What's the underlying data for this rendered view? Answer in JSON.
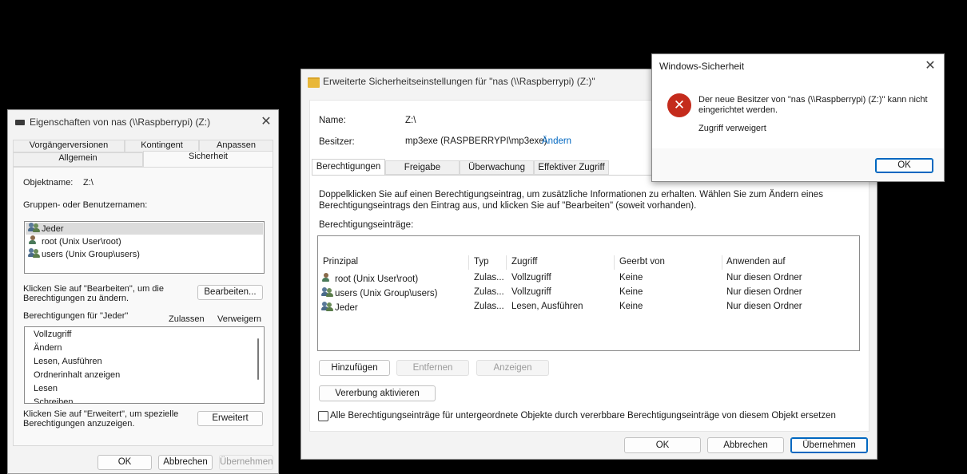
{
  "left_dialog": {
    "title": "Eigenschaften von nas (\\\\Raspberrypi) (Z:)",
    "tabs_row1": [
      "Vorgängerversionen",
      "Kontingent",
      "Anpassen"
    ],
    "tabs_row2": [
      "Allgemein",
      "Sicherheit"
    ],
    "object_name_label": "Objektname:",
    "object_name_value": "Z:\\",
    "groups_label": "Gruppen- oder Benutzernamen:",
    "groups": [
      {
        "label": "Jeder",
        "icon": "group-icon"
      },
      {
        "label": "root (Unix User\\root)",
        "icon": "user-icon"
      },
      {
        "label": "users (Unix Group\\users)",
        "icon": "group-icon"
      }
    ],
    "edit_hint": "Klicken Sie auf \"Bearbeiten\", um die Berechtigungen zu ändern.",
    "edit_button": "Bearbeiten...",
    "permissions_for": "Berechtigungen für \"Jeder\"",
    "allow_header": "Zulassen",
    "deny_header": "Verweigern",
    "permissions": [
      "Vollzugriff",
      "Ändern",
      "Lesen, Ausführen",
      "Ordnerinhalt anzeigen",
      "Lesen",
      "Schreiben"
    ],
    "advanced_hint": "Klicken Sie auf \"Erweitert\", um spezielle Berechtigungen anzuzeigen.",
    "advanced_button": "Erweitert",
    "ok": "OK",
    "cancel": "Abbrechen",
    "apply": "Übernehmen"
  },
  "middle_dialog": {
    "title": "Erweiterte Sicherheitseinstellungen für \"nas (\\\\Raspberrypi) (Z:)\"",
    "name_label": "Name:",
    "name_value": "Z:\\",
    "owner_label": "Besitzer:",
    "owner_value": "mp3exe (RASPBERRYPI\\mp3exe)",
    "change_link": "Ändern",
    "tabs": [
      "Berechtigungen",
      "Freigabe",
      "Überwachung",
      "Effektiver Zugriff"
    ],
    "info_text": "Doppelklicken Sie auf einen Berechtigungseintrag, um zusätzliche Informationen zu erhalten. Wählen Sie zum Ändern eines Berechtigungseintrags den Eintrag aus, und klicken Sie auf \"Bearbeiten\" (soweit vorhanden).",
    "entries_label": "Berechtigungseinträge:",
    "columns": [
      "Prinzipal",
      "Typ",
      "Zugriff",
      "Geerbt von",
      "Anwenden auf"
    ],
    "rows": [
      {
        "principal": "root (Unix User\\root)",
        "icon": "user-icon",
        "type": "Zulas...",
        "access": "Vollzugriff",
        "inherited": "Keine",
        "applies": "Nur diesen Ordner"
      },
      {
        "principal": "users (Unix Group\\users)",
        "icon": "group-icon",
        "type": "Zulas...",
        "access": "Vollzugriff",
        "inherited": "Keine",
        "applies": "Nur diesen Ordner"
      },
      {
        "principal": "Jeder",
        "icon": "group-icon",
        "type": "Zulas...",
        "access": "Lesen, Ausführen",
        "inherited": "Keine",
        "applies": "Nur diesen Ordner"
      }
    ],
    "add_button": "Hinzufügen",
    "remove_button": "Entfernen",
    "view_button": "Anzeigen",
    "inherit_button": "Vererbung aktivieren",
    "replace_checkbox": "Alle Berechtigungseinträge für untergeordnete Objekte durch vererbbare Berechtigungseinträge von diesem Objekt ersetzen",
    "ok": "OK",
    "cancel": "Abbrechen",
    "apply": "Übernehmen"
  },
  "error_dialog": {
    "title": "Windows-Sicherheit",
    "message": "Der neue Besitzer von \"nas (\\\\Raspberrypi) (Z:)\" kann nicht eingerichtet werden.",
    "detail": "Zugriff verweigert",
    "ok": "OK",
    "icon": "error-icon"
  },
  "colors": {
    "accent": "#0067c0",
    "error_red": "#c42b1c"
  }
}
